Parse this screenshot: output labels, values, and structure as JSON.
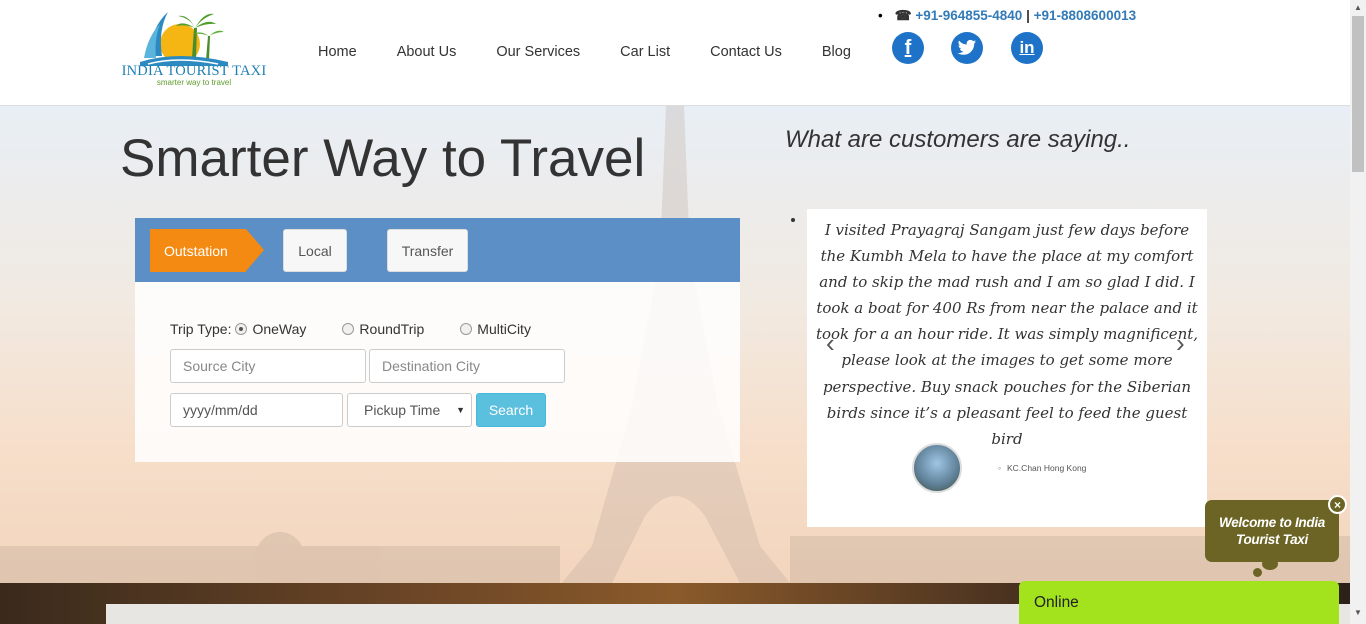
{
  "brand": {
    "name": "India Tourist Taxi",
    "tagline": "smarter way to travel",
    "name_display": "INDIA TOURIST TAXI"
  },
  "nav": {
    "items": [
      "Home",
      "About Us",
      "Our Services",
      "Car List",
      "Contact Us",
      "Blog"
    ]
  },
  "contact": {
    "phone1": "+91-964855-4840",
    "separator": "|",
    "phone2": "+91-8808600013"
  },
  "social": {
    "facebook": "f",
    "twitter_icon": "twitter-icon",
    "linkedin": "in"
  },
  "hero": {
    "title": "Smarter Way to Travel",
    "testimonials_heading": "What are customers are saying.."
  },
  "booking": {
    "tabs": [
      "Outstation",
      "Local",
      "Transfer"
    ],
    "trip_type_label": "Trip Type:",
    "trip_types": [
      "OneWay",
      "RoundTrip",
      "MultiCity"
    ],
    "selected_trip_type": "OneWay",
    "source_placeholder": "Source City",
    "destination_placeholder": "Destination City",
    "date_placeholder": "yyyy/mm/dd",
    "pickup_time": "Pickup Time",
    "search_label": "Search"
  },
  "testimonial": {
    "text": "I visited Prayagraj Sangam just few days before the Kumbh Mela to have the place at my comfort and to skip the mad rush and I am so glad I did. I took a boat for 400 Rs from near the palace and it took for a an hour ride. It was simply magnificent, please look at the images to get some more perspective. Buy snack pouches for the Siberian birds since it’s a pleasant feel to feed the guest bird",
    "author": "KC.Chan Hong Kong",
    "prev": "‹",
    "next": "›"
  },
  "chat": {
    "welcome": "Welcome to India Tourist Taxi",
    "close": "×",
    "status": "Online"
  },
  "colors": {
    "accent_orange": "#f58a12",
    "tab_bar_blue": "#5b8fc5",
    "search_blue": "#5bc0de",
    "chat_olive": "#6b6424",
    "online_green": "#a3e31d",
    "social_blue": "#1e73c8"
  }
}
